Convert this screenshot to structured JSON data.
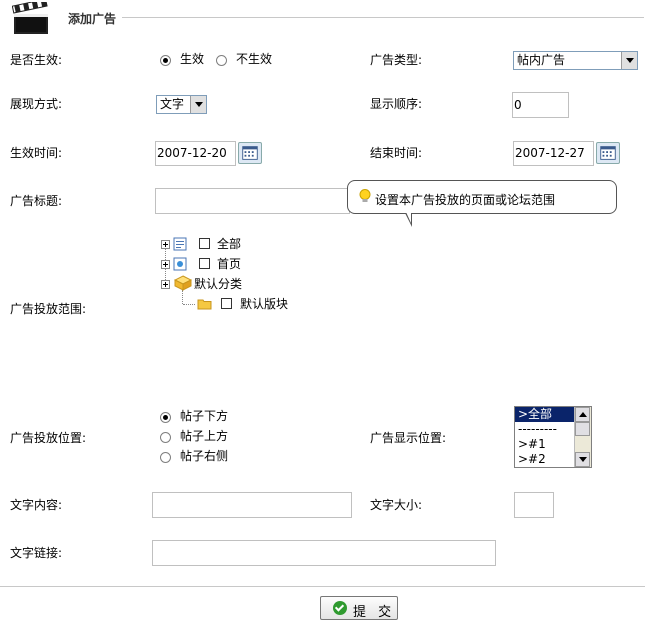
{
  "header": {
    "title": "添加广告",
    "icon": "clapperboard-icon"
  },
  "form": {
    "active": {
      "label": "是否生效:",
      "opt_on": "生效",
      "opt_off": "不生效",
      "selected": "生效"
    },
    "ad_type": {
      "label": "广告类型:",
      "value": "帖内广告"
    },
    "display_mode": {
      "label": "展现方式:",
      "value": "文字"
    },
    "display_order": {
      "label": "显示顺序:",
      "value": "0"
    },
    "start_time": {
      "label": "生效时间:",
      "value": "2007-12-20"
    },
    "end_time": {
      "label": "结束时间:",
      "value": "2007-12-27"
    },
    "ad_title": {
      "label": "广告标题:",
      "value": ""
    },
    "tooltip": {
      "text": "设置本广告投放的页面或论坛范围",
      "icon": "lightbulb-icon"
    },
    "scope": {
      "label": "广告投放范围:",
      "tree": [
        "全部",
        "首页",
        "默认分类",
        "默认版块"
      ]
    },
    "position": {
      "label": "广告投放位置:",
      "options": [
        "帖子下方",
        "帖子上方",
        "帖子右侧"
      ],
      "selected": "帖子下方"
    },
    "display_position": {
      "label": "广告显示位置:",
      "options": [
        ">全部",
        "---------",
        ">#1",
        ">#2"
      ],
      "selected": ">全部"
    },
    "text_content": {
      "label": "文字内容:",
      "value": ""
    },
    "text_size": {
      "label": "文字大小:",
      "value": ""
    },
    "text_link": {
      "label": "文字链接:",
      "value": ""
    }
  },
  "footer": {
    "submit_label": "提 交"
  },
  "colors": {
    "accent": "#0a246a",
    "border": "#c0c0c0",
    "ok_green": "#2f9a2f"
  }
}
